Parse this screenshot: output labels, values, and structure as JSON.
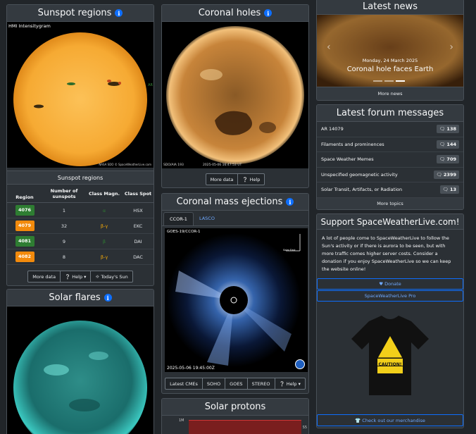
{
  "sunspot": {
    "title": "Sunspot regions",
    "img_label": "HMI Intensitygram",
    "img_credit": "NASA SDO  © SpaceWeatherLive.com",
    "img_side": "AR",
    "table_title": "Sunspot regions",
    "col_region": "Region",
    "col_number": "Number of sunspots",
    "col_magn": "Class Magn.",
    "col_spot": "Class Spot",
    "rows": [
      {
        "region": "4076",
        "count": "1",
        "magn": "α",
        "spot": "HSX",
        "color": "#2e7d32",
        "magn_color": "#2e7d32"
      },
      {
        "region": "4079",
        "count": "32",
        "magn": "β-γ",
        "spot": "EKC",
        "color": "#f28a0c",
        "magn_color": "#f0a70a"
      },
      {
        "region": "4081",
        "count": "9",
        "magn": "β",
        "spot": "DAI",
        "color": "#2e7d32",
        "magn_color": "#2e7d32"
      },
      {
        "region": "4082",
        "count": "8",
        "magn": "β-γ",
        "spot": "DAC",
        "color": "#f28a0c",
        "magn_color": "#f0a70a"
      }
    ],
    "btn_more": "More data",
    "btn_help": "Help",
    "btn_today": "Today's Sun"
  },
  "flares": {
    "title": "Solar flares"
  },
  "coronal_holes": {
    "title": "Coronal holes",
    "img_caption_left": "SDO/AIA   193",
    "img_caption_mid": "2025-05-06 16:47:53 UT",
    "btn_more": "More data",
    "btn_help": "Help"
  },
  "cme": {
    "title": "Coronal mass ejections",
    "tab1": "CCOR-1",
    "tab2": "LASCO",
    "img_label": "GOES-19/CCOR-1",
    "img_time": "2025-05-06 19:45:00Z",
    "solar_north": "Solar North",
    "solar_east": "Solar East",
    "buttons": [
      "Latest CMEs",
      "SOHO",
      "GOES",
      "STEREO",
      "Help"
    ]
  },
  "protons": {
    "title": "Solar protons",
    "y_label": "1M",
    "right_label": "S5"
  },
  "news": {
    "title": "Latest news",
    "date": "Monday, 24 March 2025",
    "headline": "Coronal hole faces Earth",
    "btn": "More news"
  },
  "forum": {
    "title": "Latest forum messages",
    "items": [
      {
        "label": "AR 14079",
        "count": "138"
      },
      {
        "label": "Filaments and prominences",
        "count": "144"
      },
      {
        "label": "Space Weather Memes",
        "count": "709"
      },
      {
        "label": "Unspecified geomagnetic activity",
        "count": "2399"
      },
      {
        "label": "Solar Transit, Artifacts, or Radiation",
        "count": "13"
      }
    ],
    "btn": "More topics"
  },
  "support": {
    "title": "Support SpaceWeatherLive.com!",
    "text": "A lot of people come to SpaceWeatherLive to follow the Sun's activity or if there is aurora to be seen, but with more traffic comes higher server costs. Consider a donation if you enjoy SpaceWeatherLive so we can keep the website online!",
    "btn_donate": "Donate",
    "btn_pro": "SpaceWeatherLive Pro",
    "shirt_caution": "CAUTION!",
    "btn_merch": "Check out our merchandise"
  },
  "colors": {
    "accent": "#0d6efd",
    "link": "#6ea8fe"
  }
}
